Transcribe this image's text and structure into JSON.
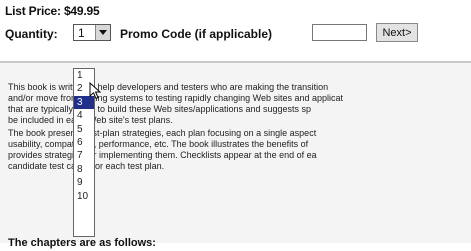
{
  "price": {
    "text": "List Price: $49.95"
  },
  "quantity": {
    "label": "Quantity:",
    "value": "1",
    "options": [
      "1",
      "2",
      "3",
      "4",
      "5",
      "6",
      "7",
      "8",
      "9",
      "10"
    ],
    "highlighted": "3"
  },
  "promo": {
    "label": "Promo Code (if applicable)",
    "value": ""
  },
  "next_button": {
    "label": "Next>"
  },
  "paragraphs": {
    "p1": [
      "This book is written to help developers and testers who are making the transition",
      "and/or move from testing systems to testing rapidly changing Web sites and applicat",
      "that are typically used to build these Web sites/applications and suggests sp",
      "be included in each Web site's test plans."
    ],
    "p2": [
      "The book presents test-plan strategies, each plan focusing on a single aspect",
      "usability, compatibility, performance, etc. The book illustrates the benefits of",
      "provides strategies for implementing them. Checklists appear at the end of ea",
      "candidate test cases for each test plan."
    ]
  },
  "chapters_heading": "The chapters are as follows:",
  "colors": {
    "highlight": "#1f2f8a",
    "panel": "#f4f4f4"
  },
  "icons": {
    "dropdown_arrow": "chevron-down-icon",
    "pointer": "mouse-cursor-icon"
  }
}
